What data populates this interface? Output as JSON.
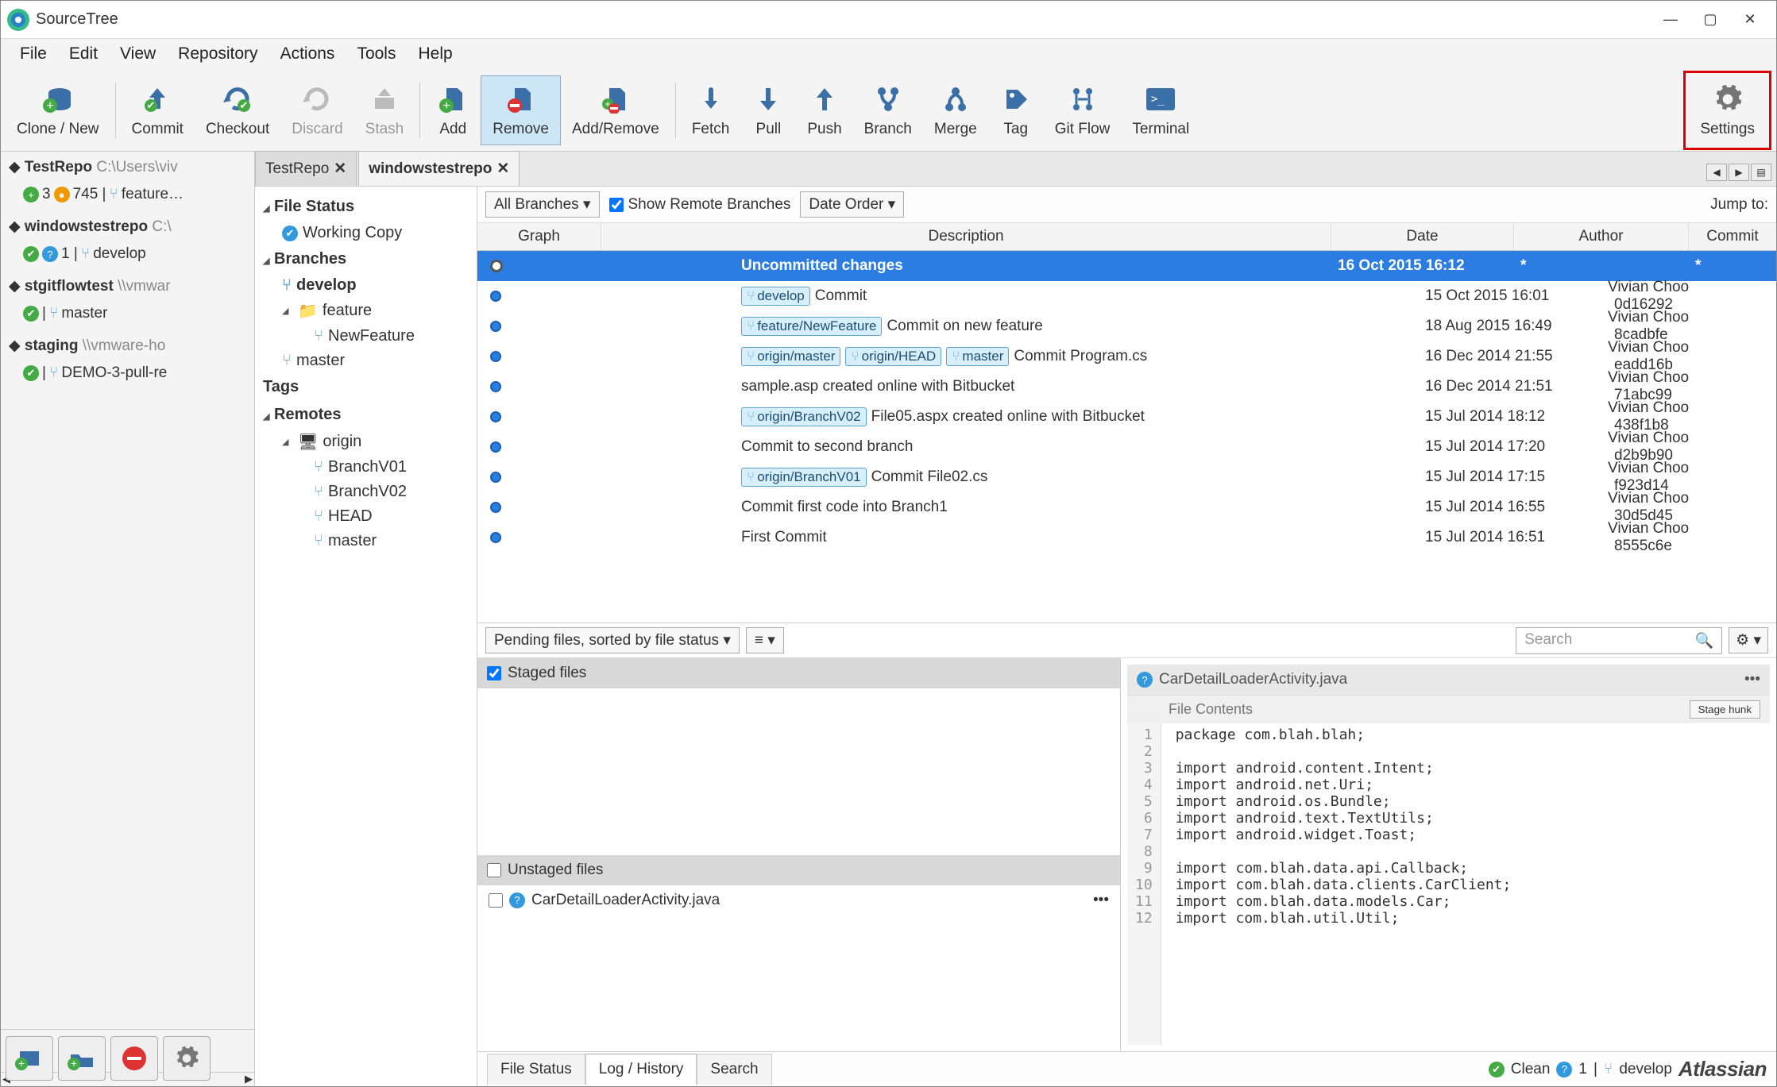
{
  "app": {
    "title": "SourceTree"
  },
  "window": {
    "min": "—",
    "max": "▢",
    "close": "✕"
  },
  "menu": [
    "File",
    "Edit",
    "View",
    "Repository",
    "Actions",
    "Tools",
    "Help"
  ],
  "toolbar": [
    {
      "id": "clone",
      "label": "Clone / New"
    },
    {
      "id": "commit",
      "label": "Commit"
    },
    {
      "id": "checkout",
      "label": "Checkout"
    },
    {
      "id": "discard",
      "label": "Discard",
      "disabled": true
    },
    {
      "id": "stash",
      "label": "Stash",
      "disabled": true
    },
    {
      "id": "add",
      "label": "Add"
    },
    {
      "id": "remove",
      "label": "Remove",
      "active": true
    },
    {
      "id": "addremove",
      "label": "Add/Remove"
    },
    {
      "id": "fetch",
      "label": "Fetch"
    },
    {
      "id": "pull",
      "label": "Pull"
    },
    {
      "id": "push",
      "label": "Push"
    },
    {
      "id": "branch",
      "label": "Branch"
    },
    {
      "id": "merge",
      "label": "Merge"
    },
    {
      "id": "tag",
      "label": "Tag"
    },
    {
      "id": "gitflow",
      "label": "Git Flow"
    },
    {
      "id": "terminal",
      "label": "Terminal"
    }
  ],
  "toolbar_settings": "Settings",
  "repos": [
    {
      "name": "TestRepo",
      "path": "C:\\Users\\viv",
      "sub_ahead": "3",
      "sub_count": "745",
      "sub_branch": "feature…"
    },
    {
      "name": "windowstestrepo",
      "path": "C:\\",
      "sub_ahead": "",
      "sub_q": "1",
      "sub_branch": "develop"
    },
    {
      "name": "stgitflowtest",
      "path": "\\\\vmwar",
      "sub_branch": "master"
    },
    {
      "name": "staging",
      "path": "\\\\vmware-ho",
      "sub_branch": "DEMO-3-pull-re"
    }
  ],
  "tabs": [
    {
      "label": "TestRepo",
      "active": false
    },
    {
      "label": "windowstestrepo",
      "active": true
    }
  ],
  "sidebar": {
    "filestatus": "File Status",
    "working": "Working Copy",
    "branches": "Branches",
    "branch_items": [
      "develop",
      "feature",
      "NewFeature",
      "master"
    ],
    "tags": "Tags",
    "remotes": "Remotes",
    "origin": "origin",
    "origin_items": [
      "BranchV01",
      "BranchV02",
      "HEAD",
      "master"
    ]
  },
  "filter": {
    "branches": "All Branches",
    "remote_chk": "Show Remote Branches",
    "order": "Date Order",
    "jump": "Jump to:"
  },
  "cols": {
    "graph": "Graph",
    "desc": "Description",
    "date": "Date",
    "author": "Author",
    "commit": "Commit"
  },
  "commits": [
    {
      "sel": true,
      "dot": "hollow",
      "tags": [],
      "msg": "Uncommitted changes",
      "date": "16 Oct 2015 16:12",
      "author": "*",
      "hash": "*"
    },
    {
      "tags": [
        "develop"
      ],
      "msg": "Commit",
      "date": "15 Oct 2015 16:01",
      "author": "Vivian Choo <vcho",
      "hash": "0d16292"
    },
    {
      "tags": [
        "feature/NewFeature"
      ],
      "msg": "Commit on new feature",
      "date": "18 Aug 2015 16:49",
      "author": "Vivian Choo <vcho",
      "hash": "8cadbfe"
    },
    {
      "tags": [
        "origin/master",
        "origin/HEAD",
        "master"
      ],
      "msg": "Commit Program.cs",
      "date": "16 Dec 2014 21:55",
      "author": "Vivian Choo <vcho",
      "hash": "eadd16b"
    },
    {
      "tags": [],
      "msg": "sample.asp created online with Bitbucket",
      "date": "16 Dec 2014 21:51",
      "author": "Vivian Choo <vcho",
      "hash": "71abc99"
    },
    {
      "tags": [
        "origin/BranchV02"
      ],
      "msg": "File05.aspx created online with Bitbucket",
      "date": "15 Jul 2014 18:12",
      "author": "Vivian Choo <vcho",
      "hash": "438f1b8"
    },
    {
      "tags": [],
      "msg": "Commit to second branch",
      "date": "15 Jul 2014 17:20",
      "author": "Vivian Choo <vcho",
      "hash": "d2b9b90"
    },
    {
      "tags": [
        "origin/BranchV01"
      ],
      "msg": "Commit File02.cs",
      "date": "15 Jul 2014 17:15",
      "author": "Vivian Choo <vcho",
      "hash": "f923d14"
    },
    {
      "tags": [],
      "msg": "Commit first code into Branch1",
      "date": "15 Jul 2014 16:55",
      "author": "Vivian Choo <vcho",
      "hash": "30d5d45"
    },
    {
      "tags": [],
      "msg": "First Commit",
      "date": "15 Jul 2014 16:51",
      "author": "Vivian Choo <vcho",
      "hash": "8555c6e"
    }
  ],
  "detail": {
    "pending": "Pending files, sorted by file status",
    "search_placeholder": "Search",
    "staged": "Staged files",
    "unstaged": "Unstaged files",
    "file": "CarDetailLoaderActivity.java",
    "diff_file": "CarDetailLoaderActivity.java",
    "file_contents": "File Contents",
    "stage_hunk": "Stage hunk",
    "code": [
      "package com.blah.blah;",
      "",
      "import android.content.Intent;",
      "import android.net.Uri;",
      "import android.os.Bundle;",
      "import android.text.TextUtils;",
      "import android.widget.Toast;",
      "",
      "import com.blah.data.api.Callback;",
      "import com.blah.data.clients.CarClient;",
      "import com.blah.data.models.Car;",
      "import com.blah.util.Util;"
    ]
  },
  "status": {
    "tabs": [
      "File Status",
      "Log / History",
      "Search"
    ],
    "active": 1,
    "clean": "Clean",
    "count": "1",
    "branch": "develop",
    "brand": "Atlassian"
  }
}
